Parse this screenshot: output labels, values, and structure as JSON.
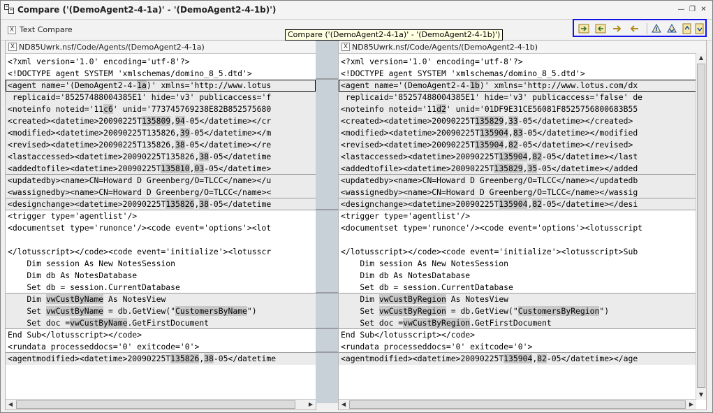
{
  "window": {
    "title": "Compare ('(DemoAgent2-4-1a)' - '(DemoAgent2-4-1b)')"
  },
  "tab": {
    "label": "Text Compare"
  },
  "tooltip": {
    "text": "Compare ('(DemoAgent2-4-1a)' - '(DemoAgent2-4-1b)')"
  },
  "toolbar": {
    "icons": [
      "copy-right-icon",
      "copy-left-icon",
      "copy-all-right-icon",
      "copy-all-left-icon",
      "previous-change-icon",
      "next-change-icon",
      "first-change-icon",
      "last-change-icon"
    ]
  },
  "left": {
    "header": "ND85Uwrk.nsf/Code/Agents/(DemoAgent2-4-1a)",
    "lines": [
      "<?xml version='1.0' encoding='utf-8'?>",
      "<!DOCTYPE agent SYSTEM 'xmlschemas/domino_8_5.dtd'>",
      "<agent name='(DemoAgent2-4-1a)' xmlns='http://www.lotus",
      " replicaid='85257488004385E1' hide='v3' publicaccess='f",
      "<noteinfo noteid='11c6' unid='773745769238E82B852575680",
      "<created><datetime>20090225T135809,94-05</datetime></cr",
      "<modified><datetime>20090225T135826,39-05</datetime></m",
      "<revised><datetime>20090225T135826,38-05</datetime></re",
      "<lastaccessed><datetime>20090225T135826,38-05</datetime",
      "<addedtofile><datetime>20090225T135810,03-05</datetime>",
      "<updatedby><name>CN=Howard D Greenberg/O=TLCC</name></u",
      "<wassignedby><name>CN=Howard D Greenberg/O=TLCC</name><",
      "<designchange><datetime>20090225T135826,38-05</datetime",
      "<trigger type='agentlist'/>",
      "<documentset type='runonce'/><code event='options'><lot",
      "",
      "</lotusscript></code><code event='initialize'><lotusscr",
      "    Dim session As New NotesSession",
      "    Dim db As NotesDatabase",
      "    Set db = session.CurrentDatabase",
      "    Dim vwCustByName As NotesView",
      "    Set vwCustByName = db.GetView(\"CustomersByName\")",
      "    Set doc =vwCustByName.GetFirstDocument",
      "End Sub</lotusscript></code>",
      "<rundata processeddocs='0' exitcode='0'>",
      "<agentmodified><datetime>20090225T135826,38-05</datetime"
    ]
  },
  "right": {
    "header": "ND85Uwrk.nsf/Code/Agents/(DemoAgent2-4-1b)",
    "lines": [
      "<?xml version='1.0' encoding='utf-8'?>",
      "<!DOCTYPE agent SYSTEM 'xmlschemas/domino_8_5.dtd'>",
      "<agent name='(DemoAgent2-4-1b)' xmlns='http://www.lotus.com/dx",
      " replicaid='85257488004385E1' hide='v3' publicaccess='false' de",
      "<noteinfo noteid='11d2' unid='01DF9E31CE56081F8525756800683B55",
      "<created><datetime>20090225T135829,33-05</datetime></created>",
      "<modified><datetime>20090225T135904,83-05</datetime></modified",
      "<revised><datetime>20090225T135904,82-05</datetime></revised>",
      "<lastaccessed><datetime>20090225T135904,82-05</datetime></last",
      "<addedtofile><datetime>20090225T135829,35-05</datetime></added",
      "<updatedby><name>CN=Howard D Greenberg/O=TLCC</name></updatedb",
      "<wassignedby><name>CN=Howard D Greenberg/O=TLCC</name></wassig",
      "<designchange><datetime>20090225T135904,82-05</datetime></desi",
      "<trigger type='agentlist'/>",
      "<documentset type='runonce'/><code event='options'><lotusscript",
      "",
      "</lotusscript></code><code event='initialize'><lotusscript>Sub",
      "    Dim session As New NotesSession",
      "    Dim db As NotesDatabase",
      "    Set db = session.CurrentDatabase",
      "    Dim vwCustByRegion As NotesView",
      "    Set vwCustByRegion = db.GetView(\"CustomersByRegion\")",
      "    Set doc =vwCustByRegion.GetFirstDocument",
      "End Sub</lotusscript></code>",
      "<rundata processeddocs='0' exitcode='0'>",
      "<agentmodified><datetime>20090225T135904,82-05</datetime></age"
    ]
  }
}
